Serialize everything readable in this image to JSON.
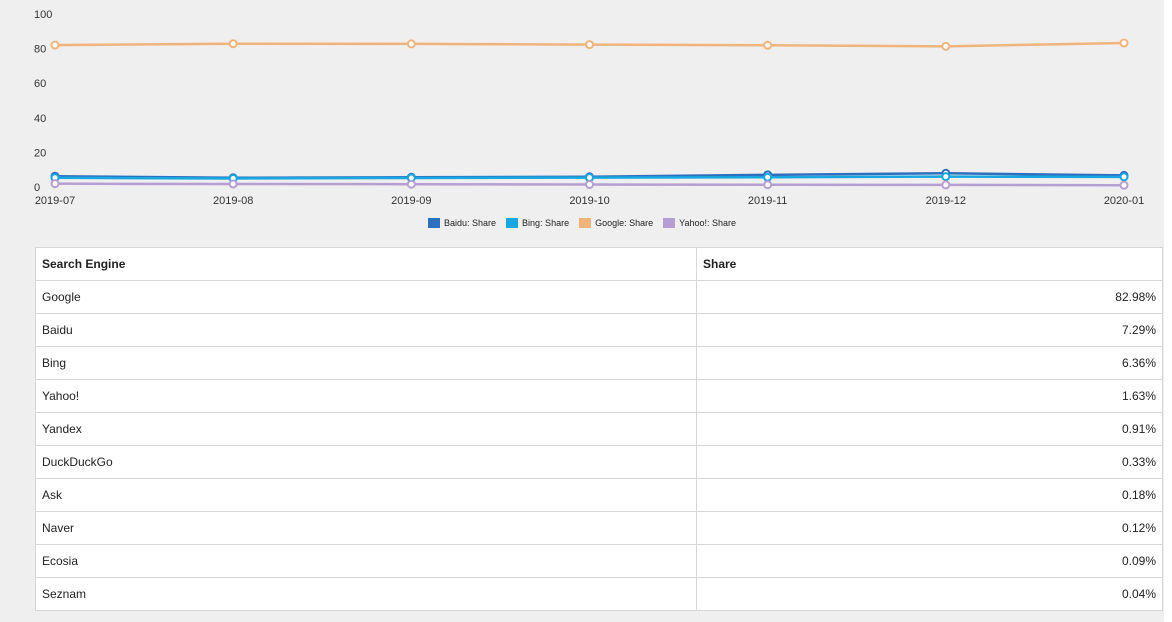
{
  "chart_data": {
    "type": "line",
    "x": [
      "2019-07",
      "2019-08",
      "2019-09",
      "2019-10",
      "2019-11",
      "2019-12",
      "2020-01"
    ],
    "y_ticks": [
      0,
      20,
      40,
      60,
      80,
      100
    ],
    "ylim": [
      0,
      100
    ],
    "grid": false,
    "legend_position": "bottom",
    "series": [
      {
        "name": "Baidu: Share",
        "color": "#2e6fbf",
        "values": [
          6.8,
          5.9,
          6.2,
          6.5,
          7.6,
          8.5,
          7.3
        ]
      },
      {
        "name": "Bing: Share",
        "color": "#18a7e0",
        "values": [
          5.9,
          5.5,
          5.8,
          6.0,
          6.2,
          6.6,
          6.4
        ]
      },
      {
        "name": "Google: Share",
        "color": "#f0b57c",
        "values": [
          82.6,
          83.4,
          83.3,
          82.9,
          82.5,
          81.9,
          83.8
        ]
      },
      {
        "name": "Yahoo!: Share",
        "color": "#b49ed3",
        "values": [
          2.5,
          2.3,
          2.2,
          2.0,
          1.9,
          1.8,
          1.6
        ]
      }
    ]
  },
  "table": {
    "headers": [
      "Search Engine",
      "Share"
    ],
    "rows": [
      [
        "Google",
        "82.98%"
      ],
      [
        "Baidu",
        "7.29%"
      ],
      [
        "Bing",
        "6.36%"
      ],
      [
        "Yahoo!",
        "1.63%"
      ],
      [
        "Yandex",
        "0.91%"
      ],
      [
        "DuckDuckGo",
        "0.33%"
      ],
      [
        "Ask",
        "0.18%"
      ],
      [
        "Naver",
        "0.12%"
      ],
      [
        "Ecosia",
        "0.09%"
      ],
      [
        "Seznam",
        "0.04%"
      ]
    ]
  }
}
